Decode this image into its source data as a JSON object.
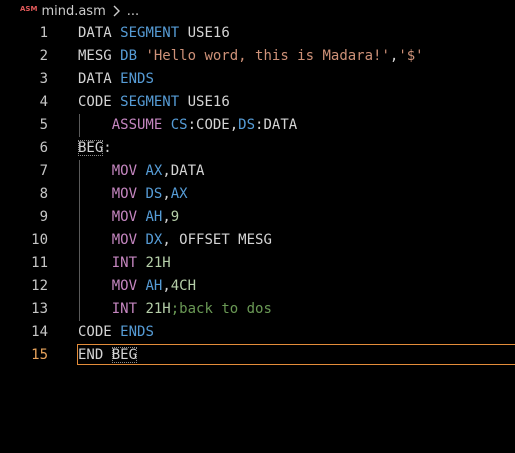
{
  "breadcrumb": {
    "badge": "ASM",
    "file": "mind.asm",
    "more": "..."
  },
  "editor": {
    "active_line": 15,
    "lines": [
      {
        "num": "1",
        "tokens": [
          [
            "DATA ",
            "tx"
          ],
          [
            "SEGMENT",
            "kw"
          ],
          [
            " USE16",
            "tx"
          ]
        ]
      },
      {
        "num": "2",
        "tokens": [
          [
            "MESG ",
            "tx"
          ],
          [
            "DB",
            "kw"
          ],
          [
            " ",
            "tx"
          ],
          [
            "'Hello word, this is Madara!'",
            "st"
          ],
          [
            ",",
            "tx"
          ],
          [
            "'$'",
            "st"
          ]
        ]
      },
      {
        "num": "3",
        "tokens": [
          [
            "DATA ",
            "tx"
          ],
          [
            "ENDS",
            "kw"
          ]
        ]
      },
      {
        "num": "4",
        "tokens": [
          [
            "CODE ",
            "tx"
          ],
          [
            "SEGMENT",
            "kw"
          ],
          [
            " USE16",
            "tx"
          ]
        ]
      },
      {
        "num": "5",
        "indent": true,
        "tokens": [
          [
            "ASSUME",
            "mn"
          ],
          [
            " ",
            "tx"
          ],
          [
            "CS",
            "rg"
          ],
          [
            ":CODE,",
            "tx"
          ],
          [
            "DS",
            "rg"
          ],
          [
            ":DATA",
            "tx"
          ]
        ]
      },
      {
        "num": "6",
        "tokens": [
          [
            "BEG",
            "tx"
          ],
          [
            ":",
            "tx"
          ]
        ],
        "boxed_token": 0
      },
      {
        "num": "7",
        "indent": true,
        "tokens": [
          [
            "MOV",
            "mn"
          ],
          [
            " ",
            "tx"
          ],
          [
            "AX",
            "rg"
          ],
          [
            ",DATA",
            "tx"
          ]
        ]
      },
      {
        "num": "8",
        "indent": true,
        "tokens": [
          [
            "MOV",
            "mn"
          ],
          [
            " ",
            "tx"
          ],
          [
            "DS",
            "rg"
          ],
          [
            ",",
            "tx"
          ],
          [
            "AX",
            "rg"
          ]
        ]
      },
      {
        "num": "9",
        "indent": true,
        "tokens": [
          [
            "MOV",
            "mn"
          ],
          [
            " ",
            "tx"
          ],
          [
            "AH",
            "rg"
          ],
          [
            ",",
            "tx"
          ],
          [
            "9",
            "nm"
          ]
        ]
      },
      {
        "num": "10",
        "indent": true,
        "tokens": [
          [
            "MOV",
            "mn"
          ],
          [
            " ",
            "tx"
          ],
          [
            "DX",
            "rg"
          ],
          [
            ", OFFSET MESG",
            "tx"
          ]
        ]
      },
      {
        "num": "11",
        "indent": true,
        "tokens": [
          [
            "INT",
            "mn"
          ],
          [
            " ",
            "tx"
          ],
          [
            "21H",
            "nm"
          ]
        ]
      },
      {
        "num": "12",
        "indent": true,
        "tokens": [
          [
            "MOV",
            "mn"
          ],
          [
            " ",
            "tx"
          ],
          [
            "AH",
            "rg"
          ],
          [
            ",",
            "tx"
          ],
          [
            "4CH",
            "nm"
          ]
        ]
      },
      {
        "num": "13",
        "indent": true,
        "tokens": [
          [
            "INT",
            "mn"
          ],
          [
            " ",
            "tx"
          ],
          [
            "21H",
            "nm"
          ],
          [
            ";back to dos",
            "cm"
          ]
        ]
      },
      {
        "num": "14",
        "tokens": [
          [
            "CODE ",
            "tx"
          ],
          [
            "ENDS",
            "kw"
          ]
        ]
      },
      {
        "num": "15",
        "tokens": [
          [
            "END ",
            "tx"
          ],
          [
            "BEG",
            "tx"
          ]
        ],
        "boxed_token": 1
      }
    ]
  }
}
